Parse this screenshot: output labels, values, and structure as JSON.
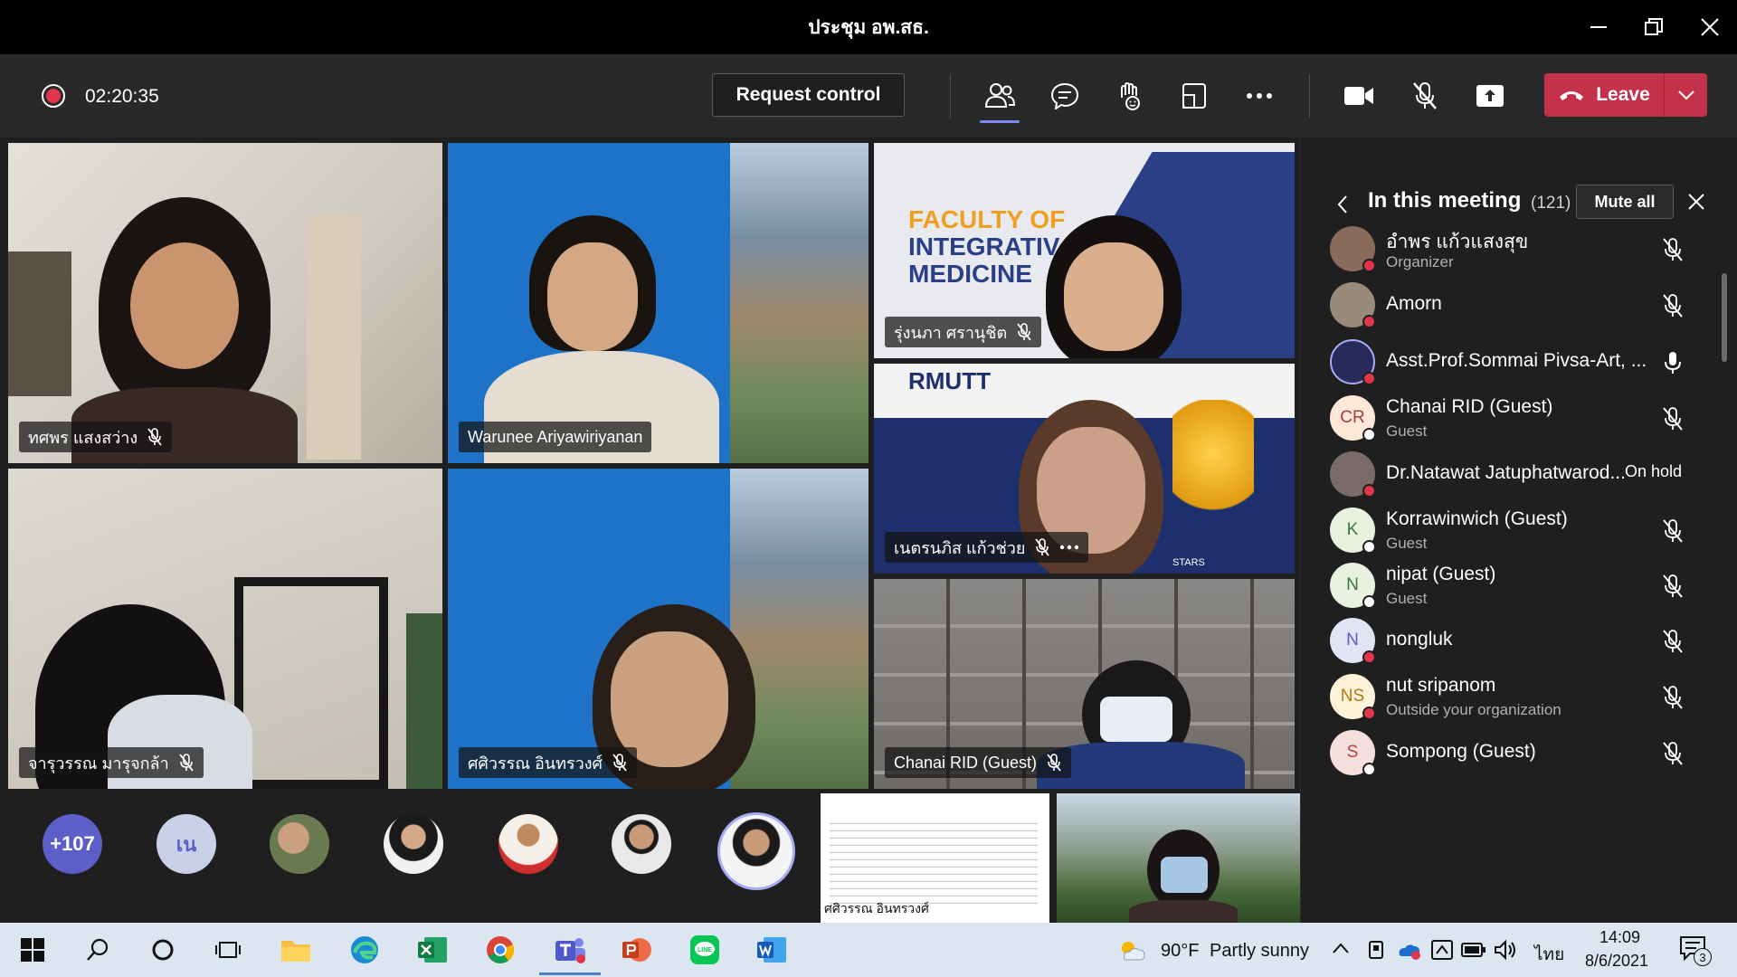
{
  "window": {
    "title": "ประชุม อพ.สธ."
  },
  "toolbar": {
    "timer": "02:20:35",
    "request_control": "Request control",
    "leave": "Leave"
  },
  "tiles": [
    {
      "name": "ทศพร แสงสว่าง"
    },
    {
      "name": "Warunee Ariyawiriyanan"
    },
    {
      "name": "รุ่งนภา ศรานุชิต"
    },
    {
      "name": "เนตรนภิส แก้วช่วย"
    },
    {
      "name": "จารุวรรณ มารุจกล้า"
    },
    {
      "name": "ศศิวรรณ อินทรวงศ์"
    },
    {
      "name": "Chanai RID (Guest)"
    }
  ],
  "slide_text": {
    "line1": "FACULTY OF",
    "line2": "INTEGRATIV",
    "line3": "MEDICINE",
    "rmutt": "RMUTT",
    "stars": "STARS"
  },
  "bottom_row": {
    "overflow": "+107",
    "initials": "เน",
    "shared_name": "ศศิวรรณ อินทรวงศ์"
  },
  "panel": {
    "title": "In this meeting",
    "count": "(121)",
    "mute_all": "Mute all",
    "participants": [
      {
        "name": "อำพร แก้วแสงสุข",
        "role": "Organizer",
        "initials": "",
        "status": "#e0354b"
      },
      {
        "name": "Amorn",
        "role": "",
        "initials": "",
        "status": "#e0354b"
      },
      {
        "name": "Asst.Prof.Sommai Pivsa-Art, ...",
        "role": "",
        "initials": "",
        "status": "#e0354b"
      },
      {
        "name": "Chanai RID (Guest)",
        "role": "Guest",
        "initials": "CR",
        "status": "#ffffff"
      },
      {
        "name": "Dr.Natawat Jatuphatwarod...",
        "role": "",
        "initials": "",
        "status": "#e0354b",
        "extra": "On hold"
      },
      {
        "name": "Korrawinwich (Guest)",
        "role": "Guest",
        "initials": "K",
        "status": "#ffffff"
      },
      {
        "name": "nipat (Guest)",
        "role": "Guest",
        "initials": "N",
        "status": "#ffffff"
      },
      {
        "name": "nongluk",
        "role": "",
        "initials": "N",
        "status": "#e0354b"
      },
      {
        "name": "nut sripanom",
        "role": "Outside your organization",
        "initials": "NS",
        "status": "#e0354b"
      },
      {
        "name": "Sompong (Guest)",
        "role": "",
        "initials": "S",
        "status": "#ffffff"
      }
    ]
  },
  "taskbar": {
    "temp": "90°F",
    "weather": "Partly sunny",
    "lang": "ไทย",
    "time": "14:09",
    "date": "8/6/2021",
    "notif_count": "3"
  },
  "colors": {
    "accent": "#7f85f5",
    "leave": "#c4314b",
    "taskbar": "#dce6f0"
  }
}
